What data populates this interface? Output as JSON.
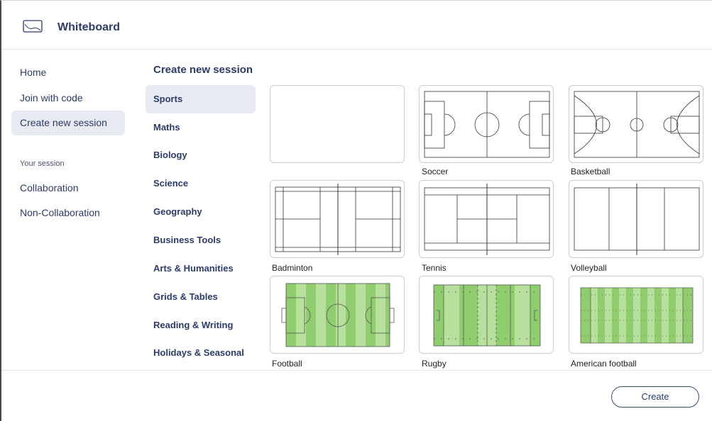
{
  "app": {
    "title": "Whiteboard",
    "icon": "whiteboard-icon"
  },
  "nav": {
    "items": [
      {
        "label": "Home",
        "active": false
      },
      {
        "label": "Join with code",
        "active": false
      },
      {
        "label": "Create new session",
        "active": true
      }
    ],
    "section_label": "Your session",
    "session_items": [
      {
        "label": "Collaboration"
      },
      {
        "label": "Non-Collaboration"
      }
    ]
  },
  "categories": {
    "title": "Create new session",
    "items": [
      {
        "label": "Sports",
        "active": true
      },
      {
        "label": "Maths"
      },
      {
        "label": "Biology"
      },
      {
        "label": "Science"
      },
      {
        "label": "Geography"
      },
      {
        "label": "Business Tools"
      },
      {
        "label": "Arts & Humanities"
      },
      {
        "label": "Grids & Tables"
      },
      {
        "label": "Reading & Writing"
      },
      {
        "label": "Holidays & Seasonal"
      }
    ]
  },
  "templates": [
    {
      "label": "",
      "kind": "blank"
    },
    {
      "label": "Soccer",
      "kind": "soccer"
    },
    {
      "label": "Basketball",
      "kind": "basketball"
    },
    {
      "label": "Badminton",
      "kind": "badminton"
    },
    {
      "label": "Tennis",
      "kind": "tennis"
    },
    {
      "label": "Volleyball",
      "kind": "volleyball"
    },
    {
      "label": "Football",
      "kind": "football"
    },
    {
      "label": "Rugby",
      "kind": "rugby"
    },
    {
      "label": "American football",
      "kind": "american-football"
    }
  ],
  "footer": {
    "create_label": "Create"
  },
  "colors": {
    "accent": "#2c3c6a",
    "active_bg": "#e8ebf2",
    "field_green": "#8fcd6e",
    "field_green_light": "#b6e09c"
  }
}
